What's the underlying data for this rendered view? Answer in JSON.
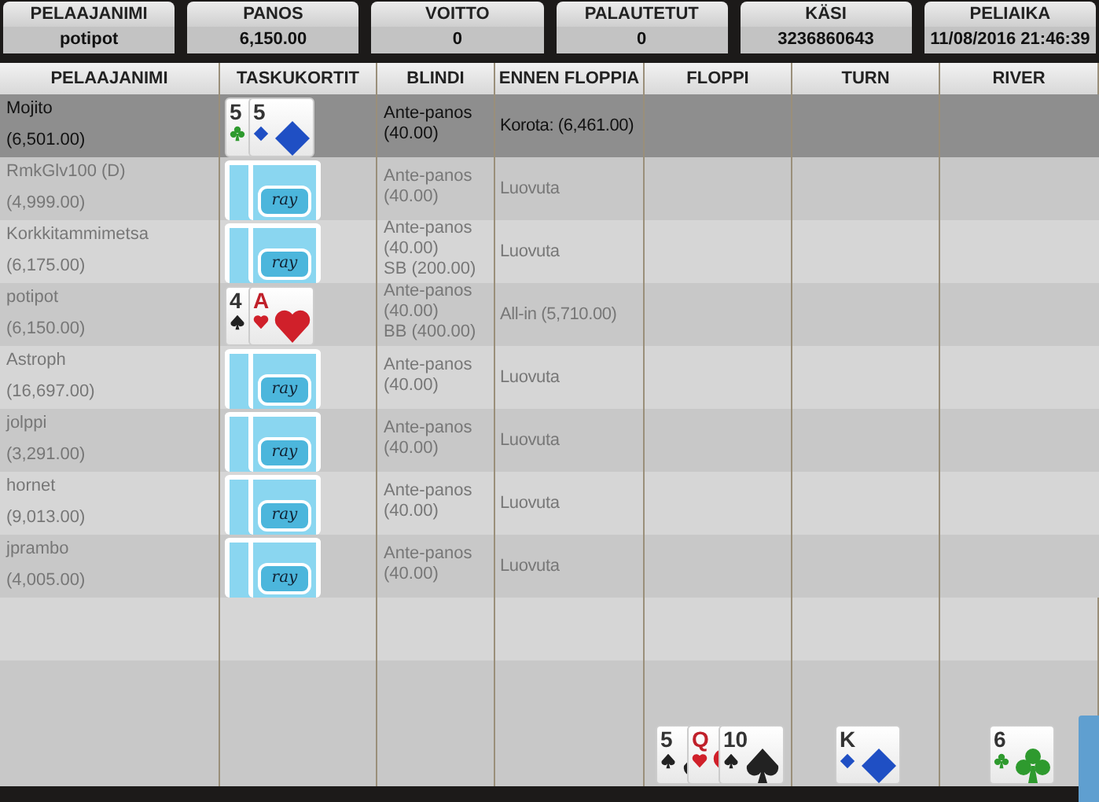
{
  "summary": [
    {
      "label": "PELAAJANIMI",
      "value": "potipot"
    },
    {
      "label": "PANOS",
      "value": "6,150.00"
    },
    {
      "label": "VOITTO",
      "value": "0"
    },
    {
      "label": "PALAUTETUT",
      "value": "0"
    },
    {
      "label": "KÄSI",
      "value": "3236860643"
    },
    {
      "label": "PELIAIKA",
      "value": "11/08/2016 21:46:39"
    }
  ],
  "table": {
    "columns": [
      "PELAAJANIMI",
      "TASKUKORTIT",
      "BLINDI",
      "ENNEN FLOPPIA",
      "FLOPPI",
      "TURN",
      "RIVER"
    ],
    "rows": [
      {
        "player": "Mojito",
        "stack": "(6,501.00)",
        "selected": true,
        "pocket": [
          {
            "kind": "clubs",
            "rank": "5"
          },
          {
            "kind": "diamonds",
            "rank": "5"
          }
        ],
        "blind": [
          "Ante-panos",
          "(40.00)"
        ],
        "preflop": "Korota: (6,461.00)"
      },
      {
        "player": "RmkGlv100 (D)",
        "stack": "(4,999.00)",
        "selected": false,
        "pocket": [
          {
            "kind": "back"
          },
          {
            "kind": "back",
            "logo": "ray"
          }
        ],
        "blind": [
          "Ante-panos",
          "(40.00)"
        ],
        "preflop": "Luovuta"
      },
      {
        "player": "Korkkitammimetsa",
        "stack": "(6,175.00)",
        "selected": false,
        "pocket": [
          {
            "kind": "back"
          },
          {
            "kind": "back",
            "logo": "ray"
          }
        ],
        "blind": [
          "Ante-panos",
          "(40.00)",
          "SB (200.00)"
        ],
        "preflop": "Luovuta"
      },
      {
        "player": "potipot",
        "stack": "(6,150.00)",
        "selected": false,
        "pocket": [
          {
            "kind": "spades",
            "rank": "4"
          },
          {
            "kind": "hearts",
            "rank": "A"
          }
        ],
        "blind": [
          "Ante-panos",
          "(40.00)",
          "BB (400.00)"
        ],
        "preflop": "All-in (5,710.00)"
      },
      {
        "player": "Astroph",
        "stack": "(16,697.00)",
        "selected": false,
        "pocket": [
          {
            "kind": "back"
          },
          {
            "kind": "back",
            "logo": "ray"
          }
        ],
        "blind": [
          "Ante-panos",
          "(40.00)"
        ],
        "preflop": "Luovuta"
      },
      {
        "player": "jolppi",
        "stack": "(3,291.00)",
        "selected": false,
        "pocket": [
          {
            "kind": "back"
          },
          {
            "kind": "back",
            "logo": "ray"
          }
        ],
        "blind": [
          "Ante-panos",
          "(40.00)"
        ],
        "preflop": "Luovuta"
      },
      {
        "player": "hornet",
        "stack": "(9,013.00)",
        "selected": false,
        "pocket": [
          {
            "kind": "back"
          },
          {
            "kind": "back",
            "logo": "ray"
          }
        ],
        "blind": [
          "Ante-panos",
          "(40.00)"
        ],
        "preflop": "Luovuta"
      },
      {
        "player": "jprambo",
        "stack": "(4,005.00)",
        "selected": false,
        "pocket": [
          {
            "kind": "back"
          },
          {
            "kind": "back",
            "logo": "ray"
          }
        ],
        "blind": [
          "Ante-panos",
          "(40.00)"
        ],
        "preflop": "Luovuta"
      }
    ],
    "board": {
      "flop": [
        {
          "kind": "spades",
          "rank": "5"
        },
        {
          "kind": "hearts",
          "rank": "Q"
        },
        {
          "kind": "spades",
          "rank": "10"
        }
      ],
      "turn": [
        {
          "kind": "diamonds",
          "rank": "K"
        }
      ],
      "river": [
        {
          "kind": "clubs",
          "rank": "6"
        }
      ]
    }
  }
}
